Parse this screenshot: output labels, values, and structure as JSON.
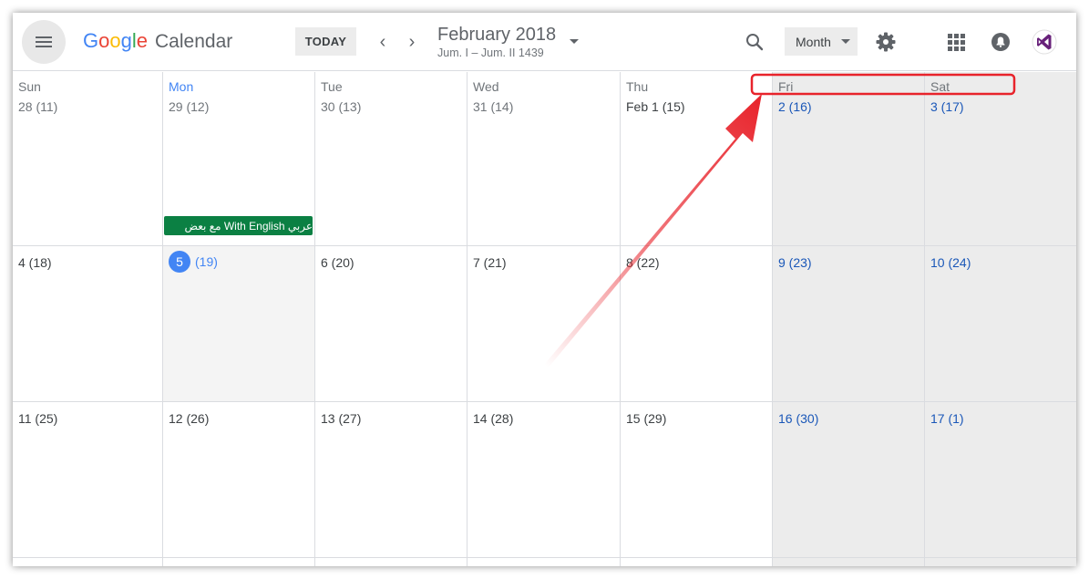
{
  "header": {
    "logo_letters": [
      "G",
      "o",
      "o",
      "g",
      "l",
      "e"
    ],
    "logo_colors": [
      "#4285f4",
      "#ea4335",
      "#fbbc05",
      "#4285f4",
      "#34a853",
      "#ea4335"
    ],
    "app_name": "Calendar",
    "today_label": "TODAY",
    "prev_glyph": "‹",
    "next_glyph": "›",
    "period_title": "February 2018",
    "period_subtitle": "Jum. I – Jum. II 1439",
    "view_selected": "Month",
    "icons": [
      "menu-icon",
      "search-icon",
      "gear-icon",
      "apps-grid-icon",
      "bell-icon",
      "visual-studio-icon"
    ]
  },
  "weekdays": [
    "Sun",
    "Mon",
    "Tue",
    "Wed",
    "Thu",
    "Fri",
    "Sat"
  ],
  "weeks": [
    [
      "28 (11)",
      "29 (12)",
      "30 (13)",
      "31 (14)",
      "Feb 1 (15)",
      "2 (16)",
      "3 (17)"
    ],
    [
      "4 (18)",
      "5",
      "6 (20)",
      "7 (21)",
      "8 (22)",
      "9 (23)",
      "10 (24)"
    ],
    [
      "11 (25)",
      "12 (26)",
      "13 (27)",
      "14 (28)",
      "15 (29)",
      "16 (30)",
      "17 (1)"
    ]
  ],
  "today_hijri": "(19)",
  "event": {
    "title": "عربي With English مع بعض",
    "color": "#0b8043"
  },
  "colors": {
    "accent": "#4285f4",
    "weekend_text": "#1a57b8",
    "annotation": "#e8232b"
  }
}
